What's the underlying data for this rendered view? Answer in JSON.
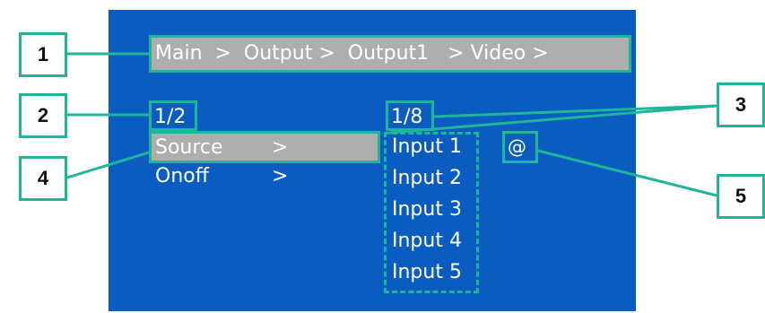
{
  "breadcrumb": {
    "text": "Main  >  Output >  Output1   > Video >"
  },
  "menu": {
    "page_indicator": "1/2",
    "items": [
      {
        "label": "Source",
        "arrow": ">"
      },
      {
        "label": "Onoff",
        "arrow": ">"
      }
    ]
  },
  "submenu": {
    "page_indicator": "1/8",
    "options": [
      "Input 1",
      "Input 2",
      "Input 3",
      "Input 4",
      "Input 5"
    ],
    "selected_marker": "@"
  },
  "callouts": [
    "1",
    "2",
    "3",
    "4",
    "5"
  ],
  "colors": {
    "screen_background": "#0b5cc0",
    "highlight_bar": "#aeaeae",
    "annotation": "#1fb59a",
    "lcd_text": "#ffffff"
  }
}
